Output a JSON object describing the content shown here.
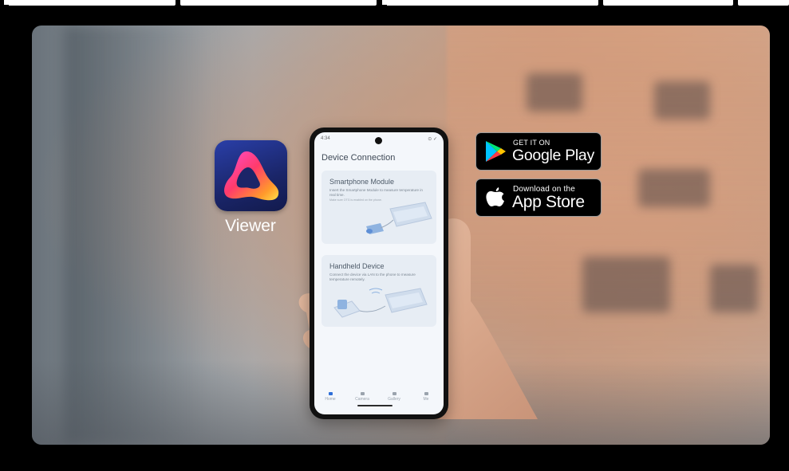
{
  "app": {
    "name": "Viewer"
  },
  "phone_screen": {
    "status_time": "4:34",
    "status_icons": "⊙ ✓",
    "title": "Device Connection",
    "cards": [
      {
        "title": "Smartphone Module",
        "description": "Insert the Smartphone Module to measure temperature in real time.",
        "note": "Make sure OTG is enabled on the phone."
      },
      {
        "title": "Handheld Device",
        "description": "Connect the device via LAN to the phone to measure temperature remotely."
      }
    ],
    "nav": [
      "Home",
      "Camera",
      "Gallery",
      "Me"
    ]
  },
  "badges": {
    "google_play": {
      "small": "GET IT ON",
      "big": "Google Play"
    },
    "app_store": {
      "small": "Download on the",
      "big": "App Store"
    }
  }
}
